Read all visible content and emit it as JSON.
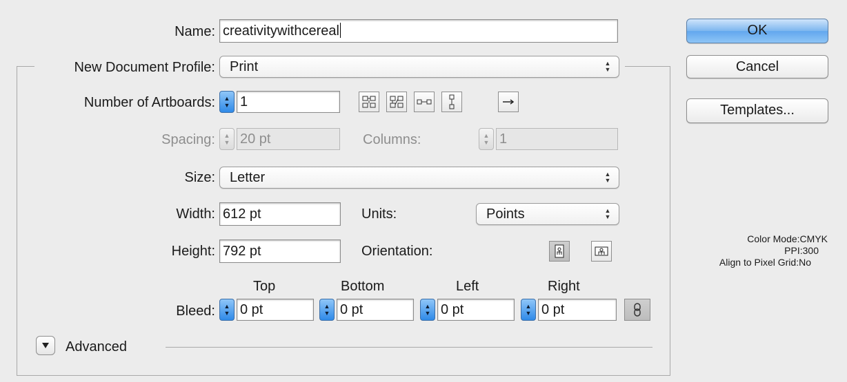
{
  "name": {
    "label": "Name:",
    "value": "creativitywithcereal"
  },
  "profile": {
    "label": "New Document Profile:",
    "value": "Print"
  },
  "artboards": {
    "label": "Number of Artboards:",
    "value": "1"
  },
  "arrange_icons": [
    "grid-by-row-icon",
    "grid-by-column-icon",
    "arrange-by-row-icon",
    "arrange-by-column-icon",
    "right-to-left-layout-icon"
  ],
  "spacing": {
    "label": "Spacing:",
    "value": "20 pt"
  },
  "columns": {
    "label": "Columns:",
    "value": "1"
  },
  "size": {
    "label": "Size:",
    "value": "Letter"
  },
  "width": {
    "label": "Width:",
    "value": "612 pt"
  },
  "units": {
    "label": "Units:",
    "value": "Points"
  },
  "height": {
    "label": "Height:",
    "value": "792 pt"
  },
  "orientation": {
    "label": "Orientation:",
    "selected": "portrait"
  },
  "bleed": {
    "label": "Bleed:",
    "headers": [
      "Top",
      "Bottom",
      "Left",
      "Right"
    ],
    "values": [
      "0 pt",
      "0 pt",
      "0 pt",
      "0 pt"
    ]
  },
  "advanced": {
    "label": "Advanced"
  },
  "buttons": {
    "ok": "OK",
    "cancel": "Cancel",
    "templates": "Templates..."
  },
  "info": {
    "color_mode_label": "Color Mode:",
    "color_mode_value": "CMYK",
    "ppi_label": "PPI:",
    "ppi_value": "300",
    "align_label": "Align to Pixel Grid:",
    "align_value": "No"
  },
  "colors": {
    "default_button": "#62a7ee",
    "stepper_blue": "#2f8ae8",
    "window_bg": "#ececec"
  }
}
